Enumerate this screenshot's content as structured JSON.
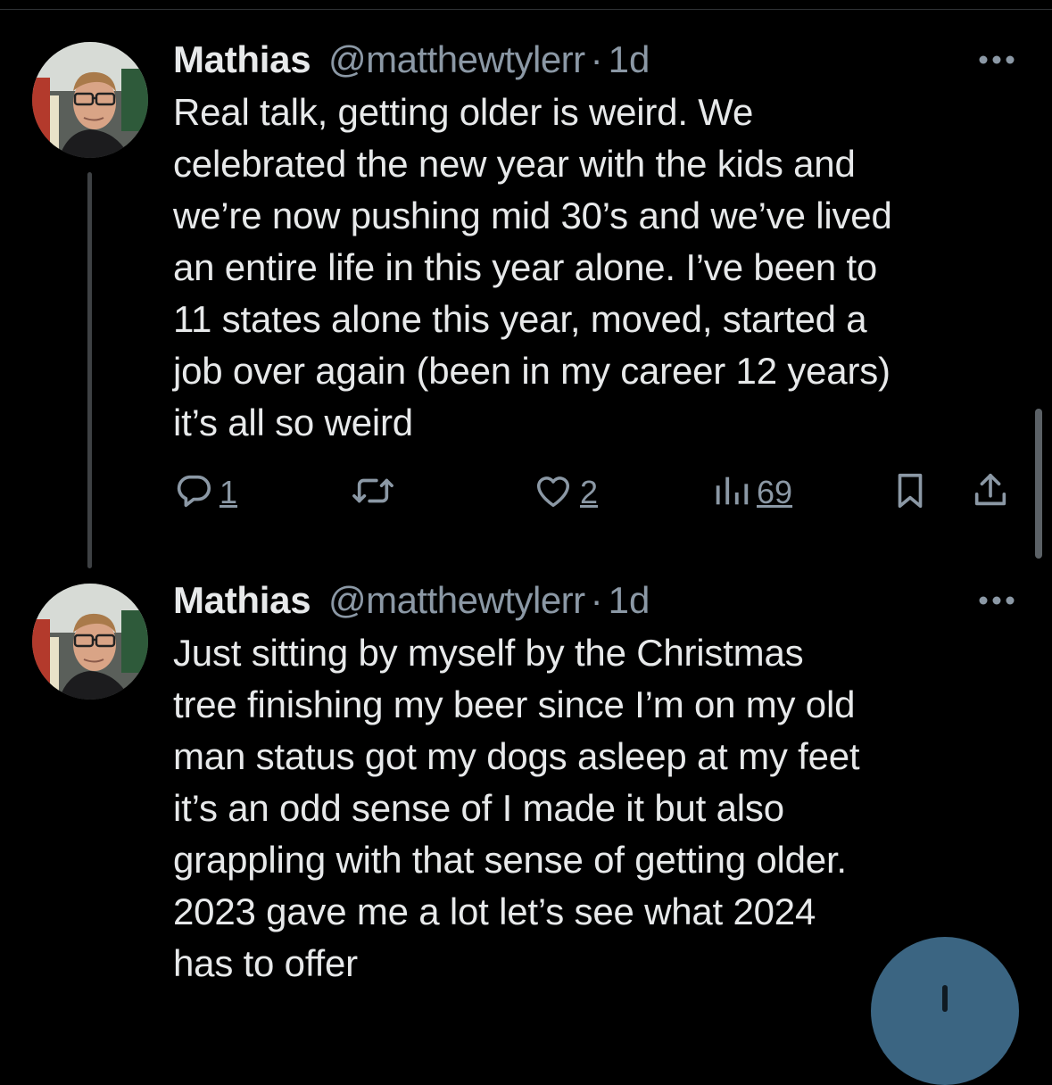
{
  "tweets": [
    {
      "name": "Mathias",
      "handle": "@matthewtylerr",
      "separator": "·",
      "time": "1d",
      "text_lines": [
        "Real talk, getting older is weird. We",
        "celebrated the new year with the kids and",
        "we’re now pushing mid 30’s and we’ve lived",
        "an entire life in this year alone. I’ve been to",
        "11 states alone this year, moved, started a",
        "job over again (been in my career 12 years)",
        "it’s all so weird"
      ],
      "reply_count": "1",
      "like_count": "2",
      "view_count": "69"
    },
    {
      "name": "Mathias",
      "handle": "@matthewtylerr",
      "separator": "·",
      "time": "1d",
      "text_lines": [
        "Just sitting by myself by the Christmas",
        "tree finishing my beer since I’m on my old",
        "man status got my dogs asleep at my feet",
        "it’s an odd sense of I made it but also",
        "grappling with that sense of getting older.",
        "2023 gave me a lot let’s see what 2024",
        "has to offer"
      ]
    }
  ],
  "icons": {
    "reply": "reply-icon",
    "retweet": "retweet-icon",
    "like": "heart-icon",
    "views": "views-icon",
    "bookmark": "bookmark-icon",
    "share": "share-icon",
    "more": "more-icon",
    "compose": "compose-plus-icon"
  },
  "colors": {
    "background": "#000000",
    "text": "#e7e9ea",
    "secondary": "#8b98a5",
    "thread_line": "#3e4144",
    "fab": "#3b6582"
  }
}
